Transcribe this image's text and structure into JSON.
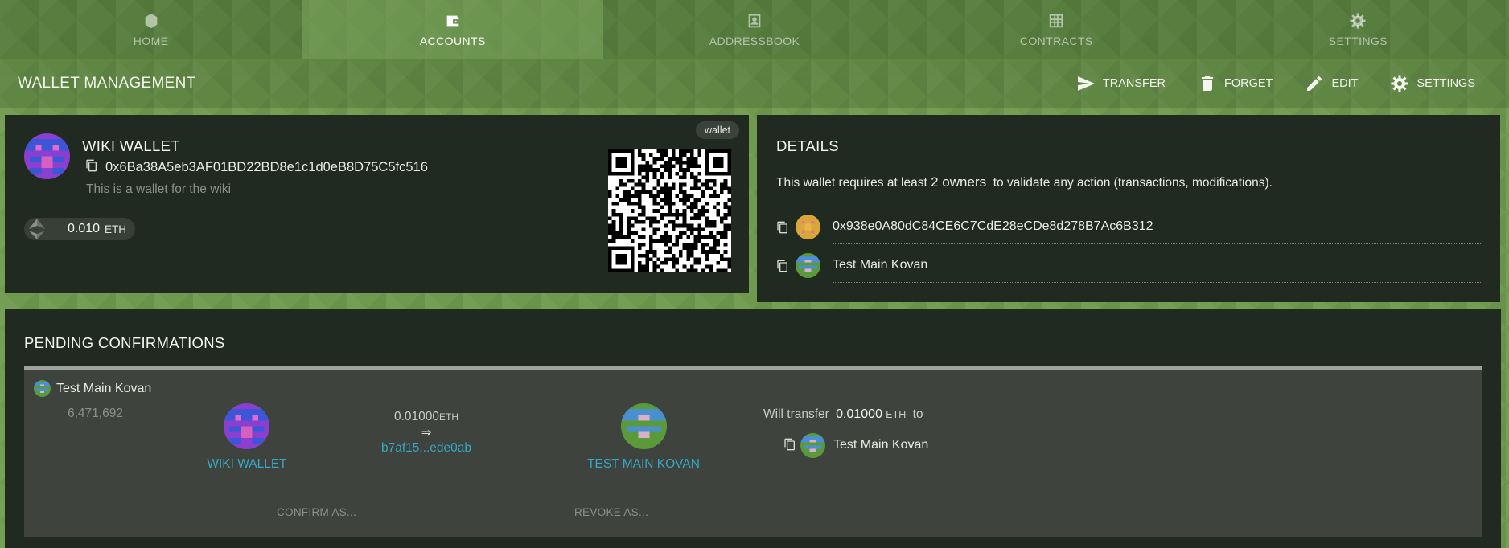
{
  "nav": {
    "tabs": [
      {
        "label": "HOME",
        "icon": "home-icon",
        "active": false
      },
      {
        "label": "ACCOUNTS",
        "icon": "wallet-icon",
        "active": true
      },
      {
        "label": "ADDRESSBOOK",
        "icon": "addressbook-icon",
        "active": false
      },
      {
        "label": "CONTRACTS",
        "icon": "contracts-grid-icon",
        "active": false
      },
      {
        "label": "SETTINGS",
        "icon": "gear-icon",
        "active": false
      }
    ]
  },
  "header": {
    "title": "WALLET MANAGEMENT",
    "actions": [
      {
        "label": "TRANSFER",
        "icon": "send-icon"
      },
      {
        "label": "FORGET",
        "icon": "trash-icon"
      },
      {
        "label": "EDIT",
        "icon": "pencil-icon"
      },
      {
        "label": "SETTINGS",
        "icon": "gear-icon"
      }
    ]
  },
  "wallet": {
    "name": "WIKI WALLET",
    "address": "0x6Ba38A5eb3AF01BD22BD8e1c1d0eB8D75C5fc516",
    "description": "This is a wallet for the wiki",
    "tag": "wallet",
    "balance": "0.010",
    "balance_unit": "ETH"
  },
  "details": {
    "title": "DETAILS",
    "text_prefix": "This wallet requires at least",
    "owners_required": "2 owners",
    "text_suffix": "to validate any action (transactions, modifications).",
    "owners": [
      {
        "label": "0x938e0A80dC84CE6C7CdE28eCDe8d278B7Ac6B312",
        "avatar_color": "#d9a63a"
      },
      {
        "label": "Test Main Kovan",
        "avatar_color": "#4a8fd0"
      }
    ]
  },
  "pending": {
    "title": "PENDING CONFIRMATIONS",
    "item": {
      "owner": "Test Main Kovan",
      "block": "6,471,692",
      "from": "WIKI WALLET",
      "amount": "0.01000",
      "amount_unit": "ETH",
      "arrow": "⇒",
      "hash": "b7af15...ede0ab",
      "to": "TEST MAIN KOVAN",
      "will_transfer": "Will transfer",
      "will_amount": "0.01000",
      "will_unit": "ETH",
      "to_word": "to",
      "destination": "Test Main Kovan",
      "confirm_label": "CONFIRM AS...",
      "revoke_label": "REVOKE AS..."
    }
  },
  "colors": {
    "background_green": "#6f9a4e",
    "panel": "#212a21",
    "link": "#36a7c7"
  }
}
